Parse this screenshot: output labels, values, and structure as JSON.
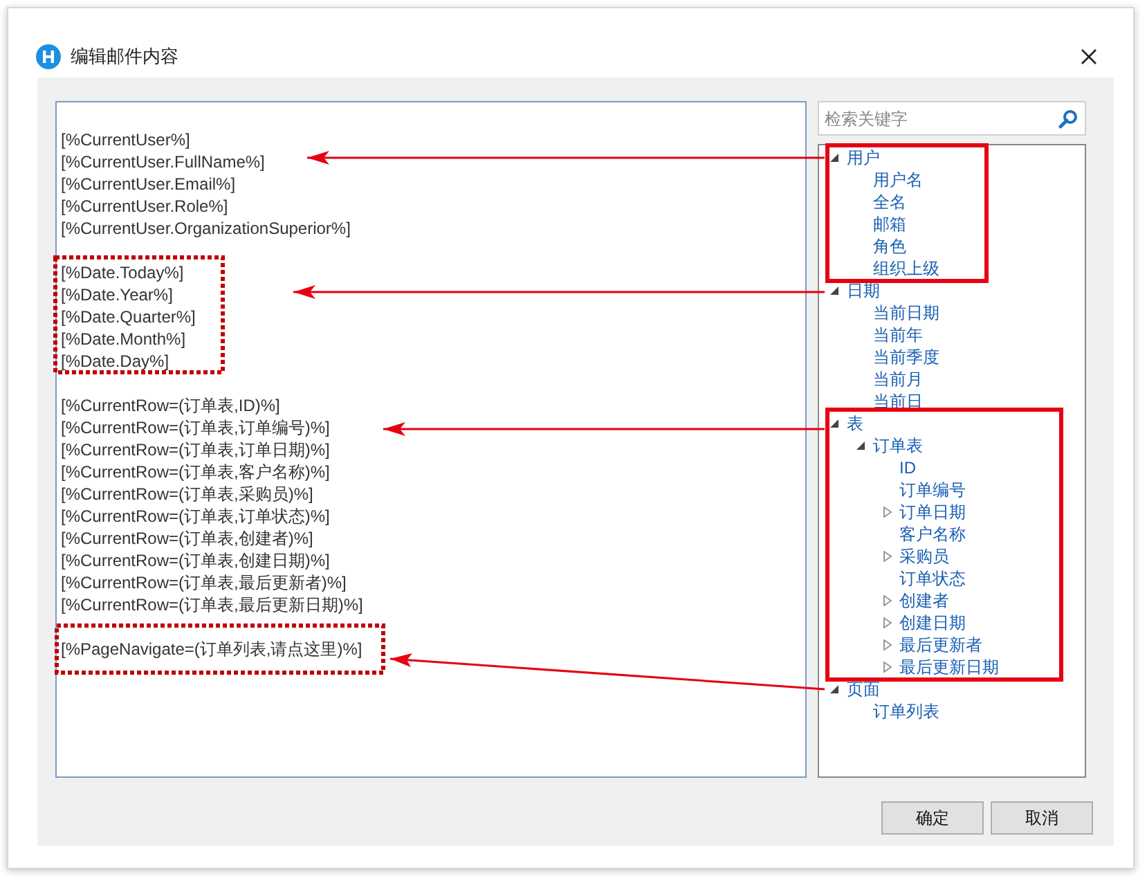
{
  "window": {
    "title": "编辑邮件内容"
  },
  "editor": {
    "blocks": [
      [
        "[%CurrentUser%]",
        "[%CurrentUser.FullName%]",
        "[%CurrentUser.Email%]",
        "[%CurrentUser.Role%]",
        "[%CurrentUser.OrganizationSuperior%]"
      ],
      [
        "[%Date.Today%]",
        "[%Date.Year%]",
        "[%Date.Quarter%]",
        "[%Date.Month%]",
        "[%Date.Day%]"
      ],
      [
        "[%CurrentRow=(订单表,ID)%]",
        "[%CurrentRow=(订单表,订单编号)%]",
        "[%CurrentRow=(订单表,订单日期)%]",
        "[%CurrentRow=(订单表,客户名称)%]",
        "[%CurrentRow=(订单表,采购员)%]",
        "[%CurrentRow=(订单表,订单状态)%]",
        "[%CurrentRow=(订单表,创建者)%]",
        "[%CurrentRow=(订单表,创建日期)%]",
        "[%CurrentRow=(订单表,最后更新者)%]",
        "[%CurrentRow=(订单表,最后更新日期)%]"
      ],
      [
        "[%PageNavigate=(订单列表,请点这里)%]"
      ]
    ]
  },
  "search": {
    "placeholder": "检索关键字"
  },
  "tree": [
    {
      "label": "用户",
      "expanded": true,
      "children": [
        {
          "label": "用户名"
        },
        {
          "label": "全名"
        },
        {
          "label": "邮箱"
        },
        {
          "label": "角色"
        },
        {
          "label": "组织上级"
        }
      ]
    },
    {
      "label": "日期",
      "expanded": true,
      "children": [
        {
          "label": "当前日期"
        },
        {
          "label": "当前年"
        },
        {
          "label": "当前季度"
        },
        {
          "label": "当前月"
        },
        {
          "label": "当前日"
        }
      ]
    },
    {
      "label": "表",
      "expanded": true,
      "children": [
        {
          "label": "订单表",
          "expanded": true,
          "children": [
            {
              "label": "ID"
            },
            {
              "label": "订单编号"
            },
            {
              "label": "订单日期",
              "expanded": false
            },
            {
              "label": "客户名称"
            },
            {
              "label": "采购员",
              "expanded": false
            },
            {
              "label": "订单状态"
            },
            {
              "label": "创建者",
              "expanded": false
            },
            {
              "label": "创建日期",
              "expanded": false
            },
            {
              "label": "最后更新者",
              "expanded": false
            },
            {
              "label": "最后更新日期",
              "expanded": false
            }
          ]
        }
      ]
    },
    {
      "label": "页面",
      "expanded": true,
      "children": [
        {
          "label": "订单列表"
        }
      ]
    }
  ],
  "buttons": [
    "确定",
    "取消"
  ]
}
